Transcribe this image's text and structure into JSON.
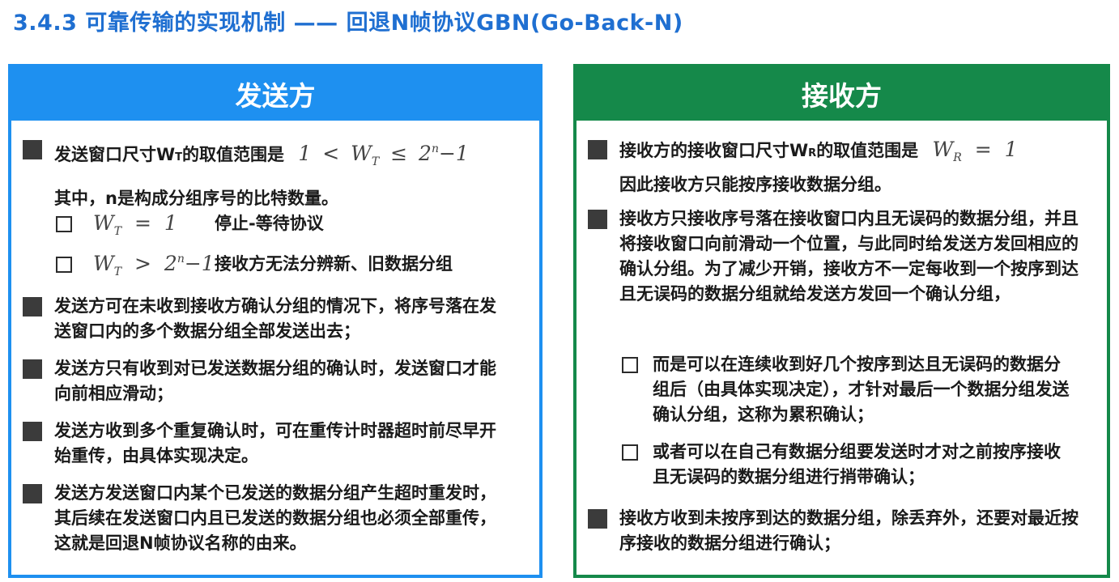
{
  "title": "3.4.3 可靠传输的实现机制 —— 回退N帧协议GBN(Go-Back-N)",
  "sender": {
    "header": "发送方",
    "item1_a": "发送窗口尺寸W",
    "item1_sub": "T",
    "item1_b": "的取值范围是",
    "item1_math_w": "W",
    "item1_math_wsub": "T",
    "item1_math_one": "1",
    "item1_math_lt": "<",
    "item1_math_le": "≤",
    "item1_math_two": "2",
    "item1_math_n": "n",
    "item1_math_minus": "−1",
    "item1_line2": "其中，n是构成分组序号的比特数量。",
    "cb1_w": "W",
    "cb1_sub": "T",
    "cb1_rel": "=",
    "cb1_val": "1",
    "cb1_text": "停止-等待协议",
    "cb2_w": "W",
    "cb2_sub": "T",
    "cb2_rel": ">",
    "cb2_two": "2",
    "cb2_n": "n",
    "cb2_minus": "−1",
    "cb2_text": "接收方无法分辨新、旧数据分组",
    "item2": "发送方可在未收到接收方确认分组的情况下，将序号落在发送窗口内的多个数据分组全部发送出去；",
    "item3": "发送方只有收到对已发送数据分组的确认时，发送窗口才能向前相应滑动；",
    "item4": "发送方收到多个重复确认时，可在重传计时器超时前尽早开始重传，由具体实现决定。",
    "item5": "发送方发送窗口内某个已发送的数据分组产生超时重发时，其后续在发送窗口内且已发送的数据分组也必须全部重传，这就是回退N帧协议名称的由来。"
  },
  "receiver": {
    "header": "接收方",
    "item1_a": "接收方的接收窗口尺寸W",
    "item1_sub": "R",
    "item1_b": "的取值范围是",
    "item1_math_w": "W",
    "item1_math_wsub": "R",
    "item1_math_rel": "=",
    "item1_math_val": "1",
    "item1_line2": "因此接收方只能按序接收数据分组。",
    "item2": "接收方只接收序号落在接收窗口内且无误码的数据分组，并且将接收窗口向前滑动一个位置，与此同时给发送方发回相应的确认分组。为了减少开销，接收方不一定每收到一个按序到达且无误码的数据分组就给发送方发回一个确认分组，",
    "cb1": "而是可以在连续收到好几个按序到达且无误码的数据分组后（由具体实现决定），才针对最后一个数据分组发送确认分组，这称为累积确认；",
    "cb2": "或者可以在自己有数据分组要发送时才对之前按序接收且无误码的数据分组进行捎带确认；",
    "item3": "接收方收到未按序到达的数据分组，除丢弃外，还要对最近按序接收的数据分组进行确认；"
  },
  "colors": {
    "title": "#1f6fd1",
    "sender_accent": "#1e90f0",
    "receiver_accent": "#15894a"
  }
}
